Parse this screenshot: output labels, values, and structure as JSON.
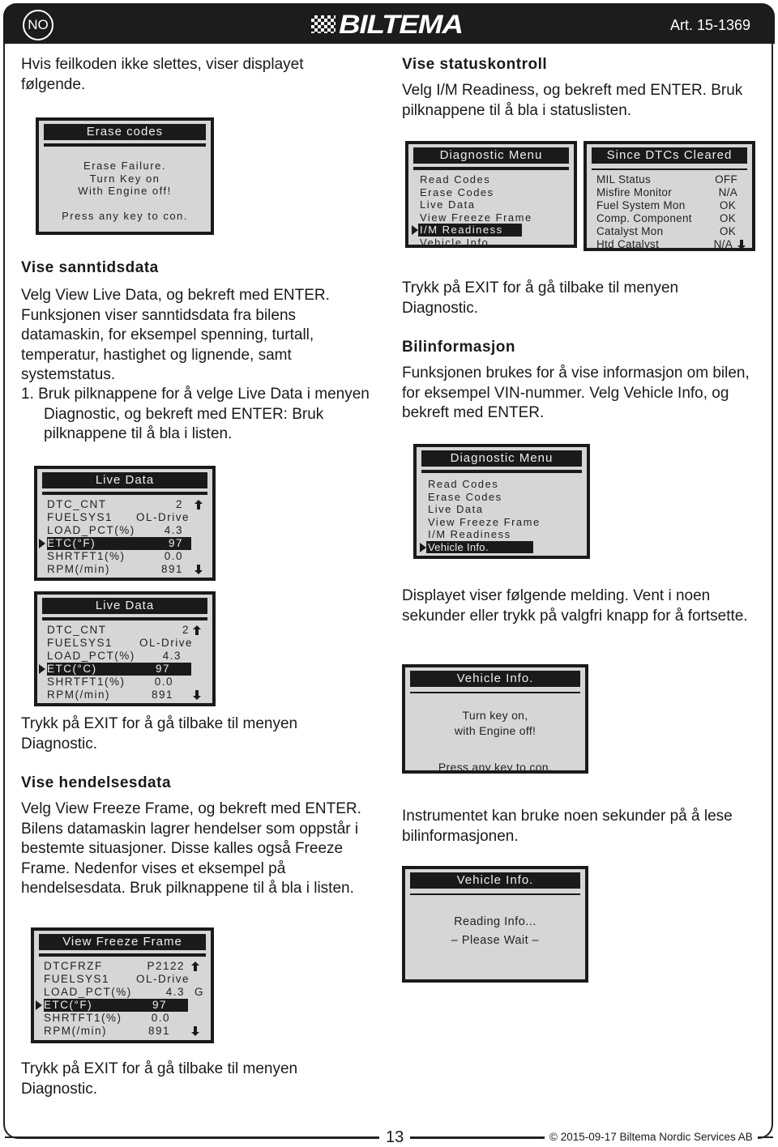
{
  "header": {
    "lang": "NO",
    "brand": "BILTEMA",
    "article": "Art. 15-1369"
  },
  "left": {
    "intro": "Hvis feilkoden ikke slettes, viser displayet følgende.",
    "erase_screen": {
      "title": "Erase codes",
      "lines": [
        "Erase Failure.",
        "Turn Key on",
        "With Engine off!"
      ],
      "prompt": "Press any key to con."
    },
    "live_heading": "Vise sanntidsdata",
    "live_body": "Velg View Live Data, og bekreft med ENTER. Funksjonen viser sanntidsdata fra bilens datamaskin, for eksempel spenning, turtall, temperatur, hastighet og lignende, samt systemstatus.",
    "live_step": "1.  Bruk pilknappene for å velge Live Data i menyen Diagnostic, og bekreft med ENTER: Bruk pilknappene til å bla i listen.",
    "live_screen_f": {
      "title": "Live Data",
      "rows": [
        {
          "k": "DTC_CNT",
          "v": "2"
        },
        {
          "k": "FUELSYS1",
          "v": "OL-Drive"
        },
        {
          "k": "LOAD_PCT(%)",
          "v": "4.3"
        },
        {
          "k": "ETC(°F)",
          "v": "97"
        },
        {
          "k": "SHRTFT1(%)",
          "v": "0.0"
        },
        {
          "k": "RPM(/min)",
          "v": "891"
        }
      ]
    },
    "live_screen_c": {
      "title": "Live Data",
      "rows": [
        {
          "k": "DTC_CNT",
          "v": "2"
        },
        {
          "k": "FUELSYS1",
          "v": "OL-Drive"
        },
        {
          "k": "LOAD_PCT(%)",
          "v": "4.3"
        },
        {
          "k": "ETC(°C)",
          "v": "97"
        },
        {
          "k": "SHRTFT1(%)",
          "v": "0.0"
        },
        {
          "k": "RPM(/min)",
          "v": "891"
        }
      ]
    },
    "exit_note_1": "Trykk på EXIT for å gå tilbake til menyen Diagnostic.",
    "freeze_heading": "Vise hendelsesdata",
    "freeze_body": "Velg View Freeze Frame, og bekreft med ENTER. Bilens datamaskin lagrer hendelser som oppstår i bestemte situasjoner. Disse kalles også Freeze Frame. Nedenfor vises et eksempel på hendelsesdata. Bruk pilknappene til å bla i listen.",
    "freeze_screen": {
      "title": "View Freeze Frame",
      "rows": [
        {
          "k": "DTCFRZF",
          "v": "P2122"
        },
        {
          "k": "FUELSYS1",
          "v": "OL-Drive"
        },
        {
          "k": "LOAD_PCT(%)",
          "v": "4.3",
          "suffix": "G"
        },
        {
          "k": "ETC(°F)",
          "v": "97"
        },
        {
          "k": "SHRTFT1(%)",
          "v": "0.0"
        },
        {
          "k": "RPM(/min)",
          "v": "891"
        }
      ]
    },
    "exit_note_2": "Trykk på EXIT for å gå tilbake til menyen Diagnostic."
  },
  "right": {
    "status_heading": "Vise statuskontroll",
    "status_body": "Velg I/M Readiness, og bekreft med ENTER. Bruk pilknappene til å bla i statuslisten.",
    "diag_menu_1": {
      "title": "Diagnostic Menu",
      "items": [
        "Read Codes",
        "Erase Codes",
        "Live Data",
        "View Freeze Frame",
        "I/M Readiness",
        "Vehicle Info."
      ],
      "selected": "I/M Readiness"
    },
    "dtc_screen": {
      "title": "Since DTCs Cleared",
      "rows": [
        {
          "k": "MIL Status",
          "v": "OFF"
        },
        {
          "k": "Misfire Monitor",
          "v": "N/A"
        },
        {
          "k": "Fuel System Mon",
          "v": "OK"
        },
        {
          "k": "Comp. Component",
          "v": "OK"
        },
        {
          "k": "Catalyst Mon",
          "v": "OK"
        },
        {
          "k": "Htd Catalyst",
          "v": "N/A"
        }
      ]
    },
    "exit_note": "Trykk på EXIT for å gå tilbake til menyen Diagnostic.",
    "vehicle_heading": "Bilinformasjon",
    "vehicle_body": "Funksjonen brukes for å vise informasjon om bilen, for eksempel VIN-nummer. Velg Vehicle Info, og bekreft med ENTER.",
    "diag_menu_2": {
      "title": "Diagnostic Menu",
      "items": [
        "Read Codes",
        "Erase Codes",
        "Live Data",
        "View Freeze Frame",
        "I/M Readiness",
        "Vehicle Info."
      ],
      "selected": "Vehicle Info."
    },
    "message_note": "Displayet viser følgende melding. Vent i noen sekunder eller trykk på valgfri knapp for å fortsette.",
    "vehicle_screen_1": {
      "title": "Vehicle Info.",
      "lines": [
        "Turn key on,",
        "with Engine off!"
      ],
      "prompt": "Press any key to con."
    },
    "reading_note": "Instrumentet kan bruke noen sekunder på å lese bilinformasjonen.",
    "vehicle_screen_2": {
      "title": "Vehicle Info.",
      "lines": [
        "Reading Info...",
        "– Please Wait –"
      ]
    }
  },
  "footer": {
    "page": "13",
    "copyright": "© 2015-09-17 Biltema Nordic Services AB"
  }
}
